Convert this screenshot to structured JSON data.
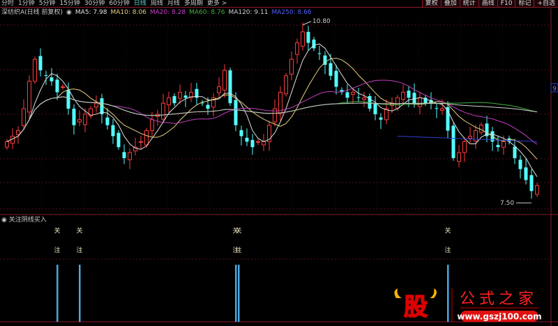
{
  "tabs": [
    "分时",
    "1分钟",
    "5分钟",
    "15分钟",
    "30分钟",
    "60分钟",
    "日线",
    "周线",
    "月线",
    "多周期",
    "更多 >"
  ],
  "active_tab": "日线",
  "right_buttons": [
    "复权",
    "叠加",
    "统计",
    "画线",
    "F10",
    "标记",
    "+自选"
  ],
  "info": {
    "title": "深纺织A(日线 前复权)",
    "ma5": "MA5: 7.98",
    "ma10": "MA10: 8.06",
    "ma20": "MA20: 8.28",
    "ma60": "MA60: 8.76",
    "ma120": "MA120: 9.11",
    "ma250": "MA250: 8.66"
  },
  "colors": {
    "up": "#ff3c3c",
    "down": "#54ffff",
    "ma5": "#e0e0e0",
    "ma10": "#e8d080",
    "ma20": "#c040c0",
    "ma60": "#40b040",
    "ma120": "#d0d0d0",
    "ma250": "#3040d0",
    "grid": "#5a1020",
    "signal": "#4aa8e0"
  },
  "axis_label": "9",
  "high_label": "10.80",
  "low_label": "7.50",
  "indicator": {
    "title": "关注阴线买入",
    "char1": "关",
    "char2": "注"
  },
  "logo": {
    "icon_char": "股",
    "name": "公式之家",
    "url": "www.gszj100.com"
  },
  "chart_data": {
    "type": "candlestick",
    "ylim": [
      7.5,
      10.8
    ],
    "closes": [
      8.6,
      8.7,
      8.8,
      9.2,
      9.7,
      10.1,
      9.9,
      9.8,
      9.7,
      9.5,
      9.6,
      9.2,
      8.9,
      9.0,
      9.1,
      9.2,
      9.3,
      9.1,
      8.9,
      8.7,
      8.5,
      8.3,
      8.4,
      8.5,
      8.6,
      8.8,
      9.0,
      9.1,
      9.3,
      9.4,
      9.3,
      9.5,
      9.4,
      9.5,
      9.4,
      9.3,
      9.2,
      9.4,
      9.6,
      9.9,
      9.3,
      8.9,
      8.7,
      8.6,
      8.5,
      8.6,
      8.6,
      8.9,
      9.2,
      9.5,
      9.8,
      10.1,
      10.4,
      10.6,
      10.4,
      10.3,
      10.2,
      10.0,
      9.8,
      9.6,
      9.5,
      9.4,
      9.5,
      9.4,
      9.4,
      9.2,
      9.1,
      9.0,
      9.2,
      9.3,
      9.4,
      9.5,
      9.4,
      9.3,
      9.4,
      9.3,
      9.3,
      9.2,
      9.2,
      8.8,
      8.3,
      8.4,
      8.6,
      8.7,
      8.8,
      8.9,
      8.7,
      8.6,
      8.5,
      8.6,
      8.6,
      8.3,
      8.1,
      7.9,
      7.7,
      7.8
    ],
    "signal_bars": [
      9,
      13,
      41,
      42,
      79
    ]
  }
}
